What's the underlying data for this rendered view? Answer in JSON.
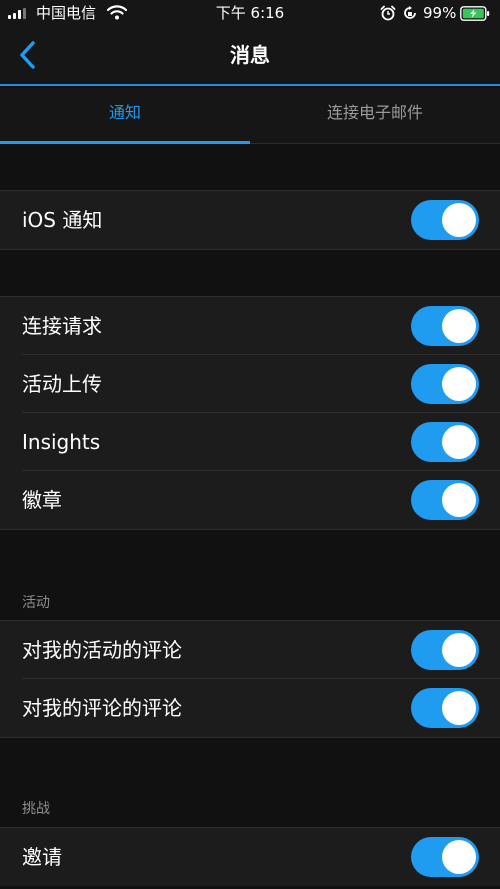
{
  "status_bar": {
    "carrier": "中国电信",
    "time": "下午 6:16",
    "battery": "99%"
  },
  "nav": {
    "title": "消息"
  },
  "tabs": [
    {
      "label": "通知",
      "selected": true
    },
    {
      "label": "连接电子邮件",
      "selected": false
    }
  ],
  "ios": {
    "label": "iOS 通知",
    "on": true
  },
  "notifications": [
    {
      "label": "连接请求",
      "on": true
    },
    {
      "label": "活动上传",
      "on": true
    },
    {
      "label": "Insights",
      "on": true
    },
    {
      "label": "徽章",
      "on": true
    }
  ],
  "activity": {
    "header": "活动",
    "items": [
      {
        "label": "对我的活动的评论",
        "on": true
      },
      {
        "label": "对我的评论的评论",
        "on": true
      }
    ]
  },
  "challenges": {
    "header": "挑战",
    "items": [
      {
        "label": "邀请",
        "on": true
      }
    ]
  },
  "colors": {
    "accent": "#1f9bf0",
    "background": "#111111",
    "row_background": "#1c1c1c"
  }
}
